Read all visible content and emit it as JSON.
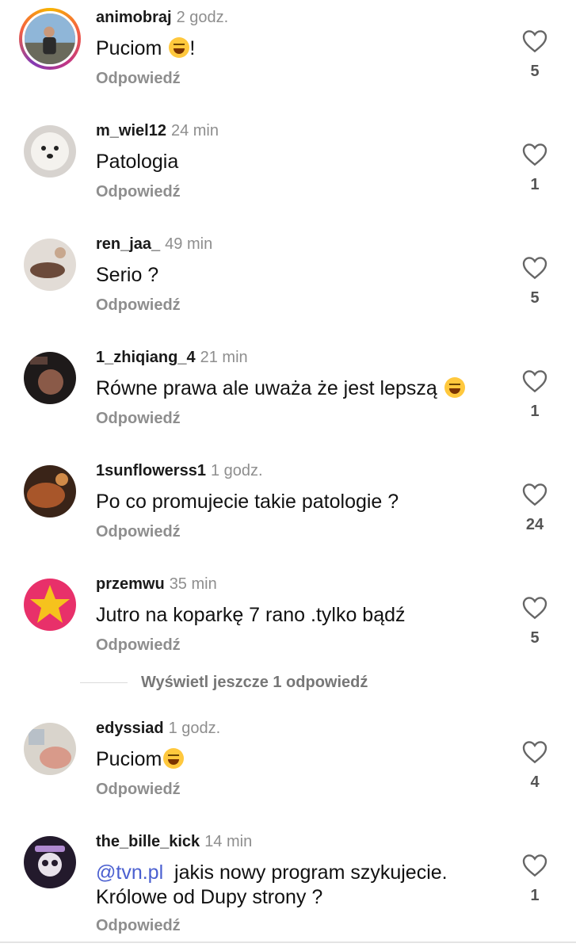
{
  "reply_label": "Odpowiedź",
  "show_more_label": "Wyświetl jeszcze 1 odpowiedź",
  "comments": [
    {
      "user": "animobraj",
      "time": "2 godz.",
      "text": "Puciom",
      "text_suffix": "!",
      "emoji": "laughing-tears",
      "likes": "5"
    },
    {
      "user": "m_wiel12",
      "time": "24 min",
      "text": "Patologia",
      "likes": "1"
    },
    {
      "user": "ren_jaa_",
      "time": "49 min",
      "text": "Serio ?",
      "likes": "5"
    },
    {
      "user": "1_zhiqiang_4",
      "time": "21 min",
      "text": "Równe prawa ale uważa że jest lepszą",
      "emoji": "grinning-squint",
      "likes": "1"
    },
    {
      "user": "1sunflowerss1",
      "time": "1 godz.",
      "text": "Po co promujecie takie patologie ?",
      "likes": "24"
    },
    {
      "user": "przemwu",
      "time": "35 min",
      "text": "Jutro na koparkę 7 rano .tylko bądź",
      "likes": "5"
    },
    {
      "user": "edyssiad",
      "time": "1 godz.",
      "text": "Puciom",
      "emoji": "laughing-tears",
      "likes": "4"
    },
    {
      "user": "the_bille_kick",
      "time": "14 min",
      "mention": "@tvn.pl",
      "text": "jakis nowy program szykujecie.",
      "text_line2": "Królowe od Dupy strony ?",
      "likes": "1"
    }
  ]
}
